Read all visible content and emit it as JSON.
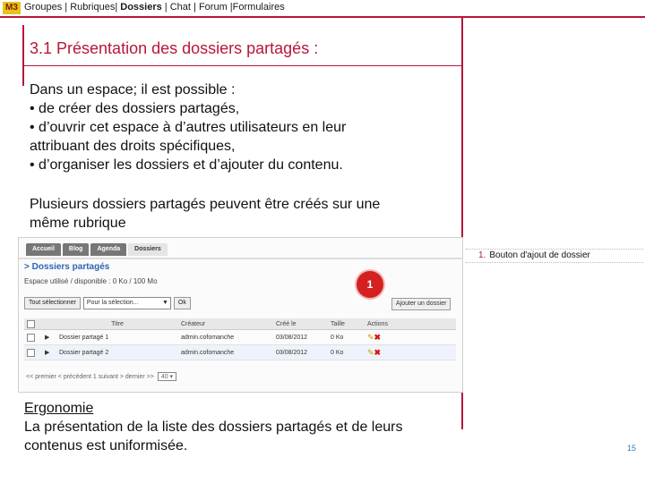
{
  "header": {
    "logo": "M3",
    "nav": {
      "groupes": "Groupes",
      "rubriques": "Rubriques",
      "dossiers": "Dossiers",
      "chat": "Chat",
      "forum": "Forum",
      "formulaires": "Formulaires"
    }
  },
  "slide": {
    "title": "3.1 Présentation des dossiers partagés :",
    "intro": "Dans un espace; il est possible :",
    "bullets": [
      "•  de créer des dossiers partagés,",
      "•  d’ouvrir cet espace à d’autres utilisateurs en leur",
      "attribuant des droits spécifiques,",
      "•  d’organiser les dossiers et d’ajouter du contenu."
    ],
    "para2": [
      "Plusieurs dossiers partagés peuvent être créés sur une",
      "même rubrique"
    ],
    "ergonomie": {
      "heading": "Ergonomie",
      "lines": [
        "La présentation de la liste des dossiers partagés et de leurs",
        "contenus est uniformisée."
      ]
    },
    "page_number": "15"
  },
  "callout": {
    "marker": "1",
    "annotation_number": "1.",
    "annotation_text": "Bouton d'ajout de dossier"
  },
  "screenshot": {
    "tabs": [
      "Accueil",
      "Blog",
      "Agenda",
      "Dossiers"
    ],
    "heading": "> Dossiers partagés",
    "space": "Espace utilisé / disponible : 0 Ko / 100 Mo",
    "select_all": "Tout sélectionner",
    "selection_placeholder": "Pour la sélection...",
    "ok": "Ok",
    "add_folder": "Ajouter un dossier",
    "columns": [
      "",
      "Titre",
      "Créateur",
      "Créé le",
      "Taille",
      "Actions"
    ],
    "rows": [
      {
        "title": "Dossier partagé 1",
        "creator": "admin.cofomanche",
        "date": "03/08/2012",
        "size": "0 Ko"
      },
      {
        "title": "Dossier partagé 2",
        "creator": "admin.cofomanche",
        "date": "03/08/2012",
        "size": "0 Ko"
      }
    ],
    "pager": "<< premier  < précédent   1   suivant >  dernier >>",
    "per_page": "40"
  }
}
